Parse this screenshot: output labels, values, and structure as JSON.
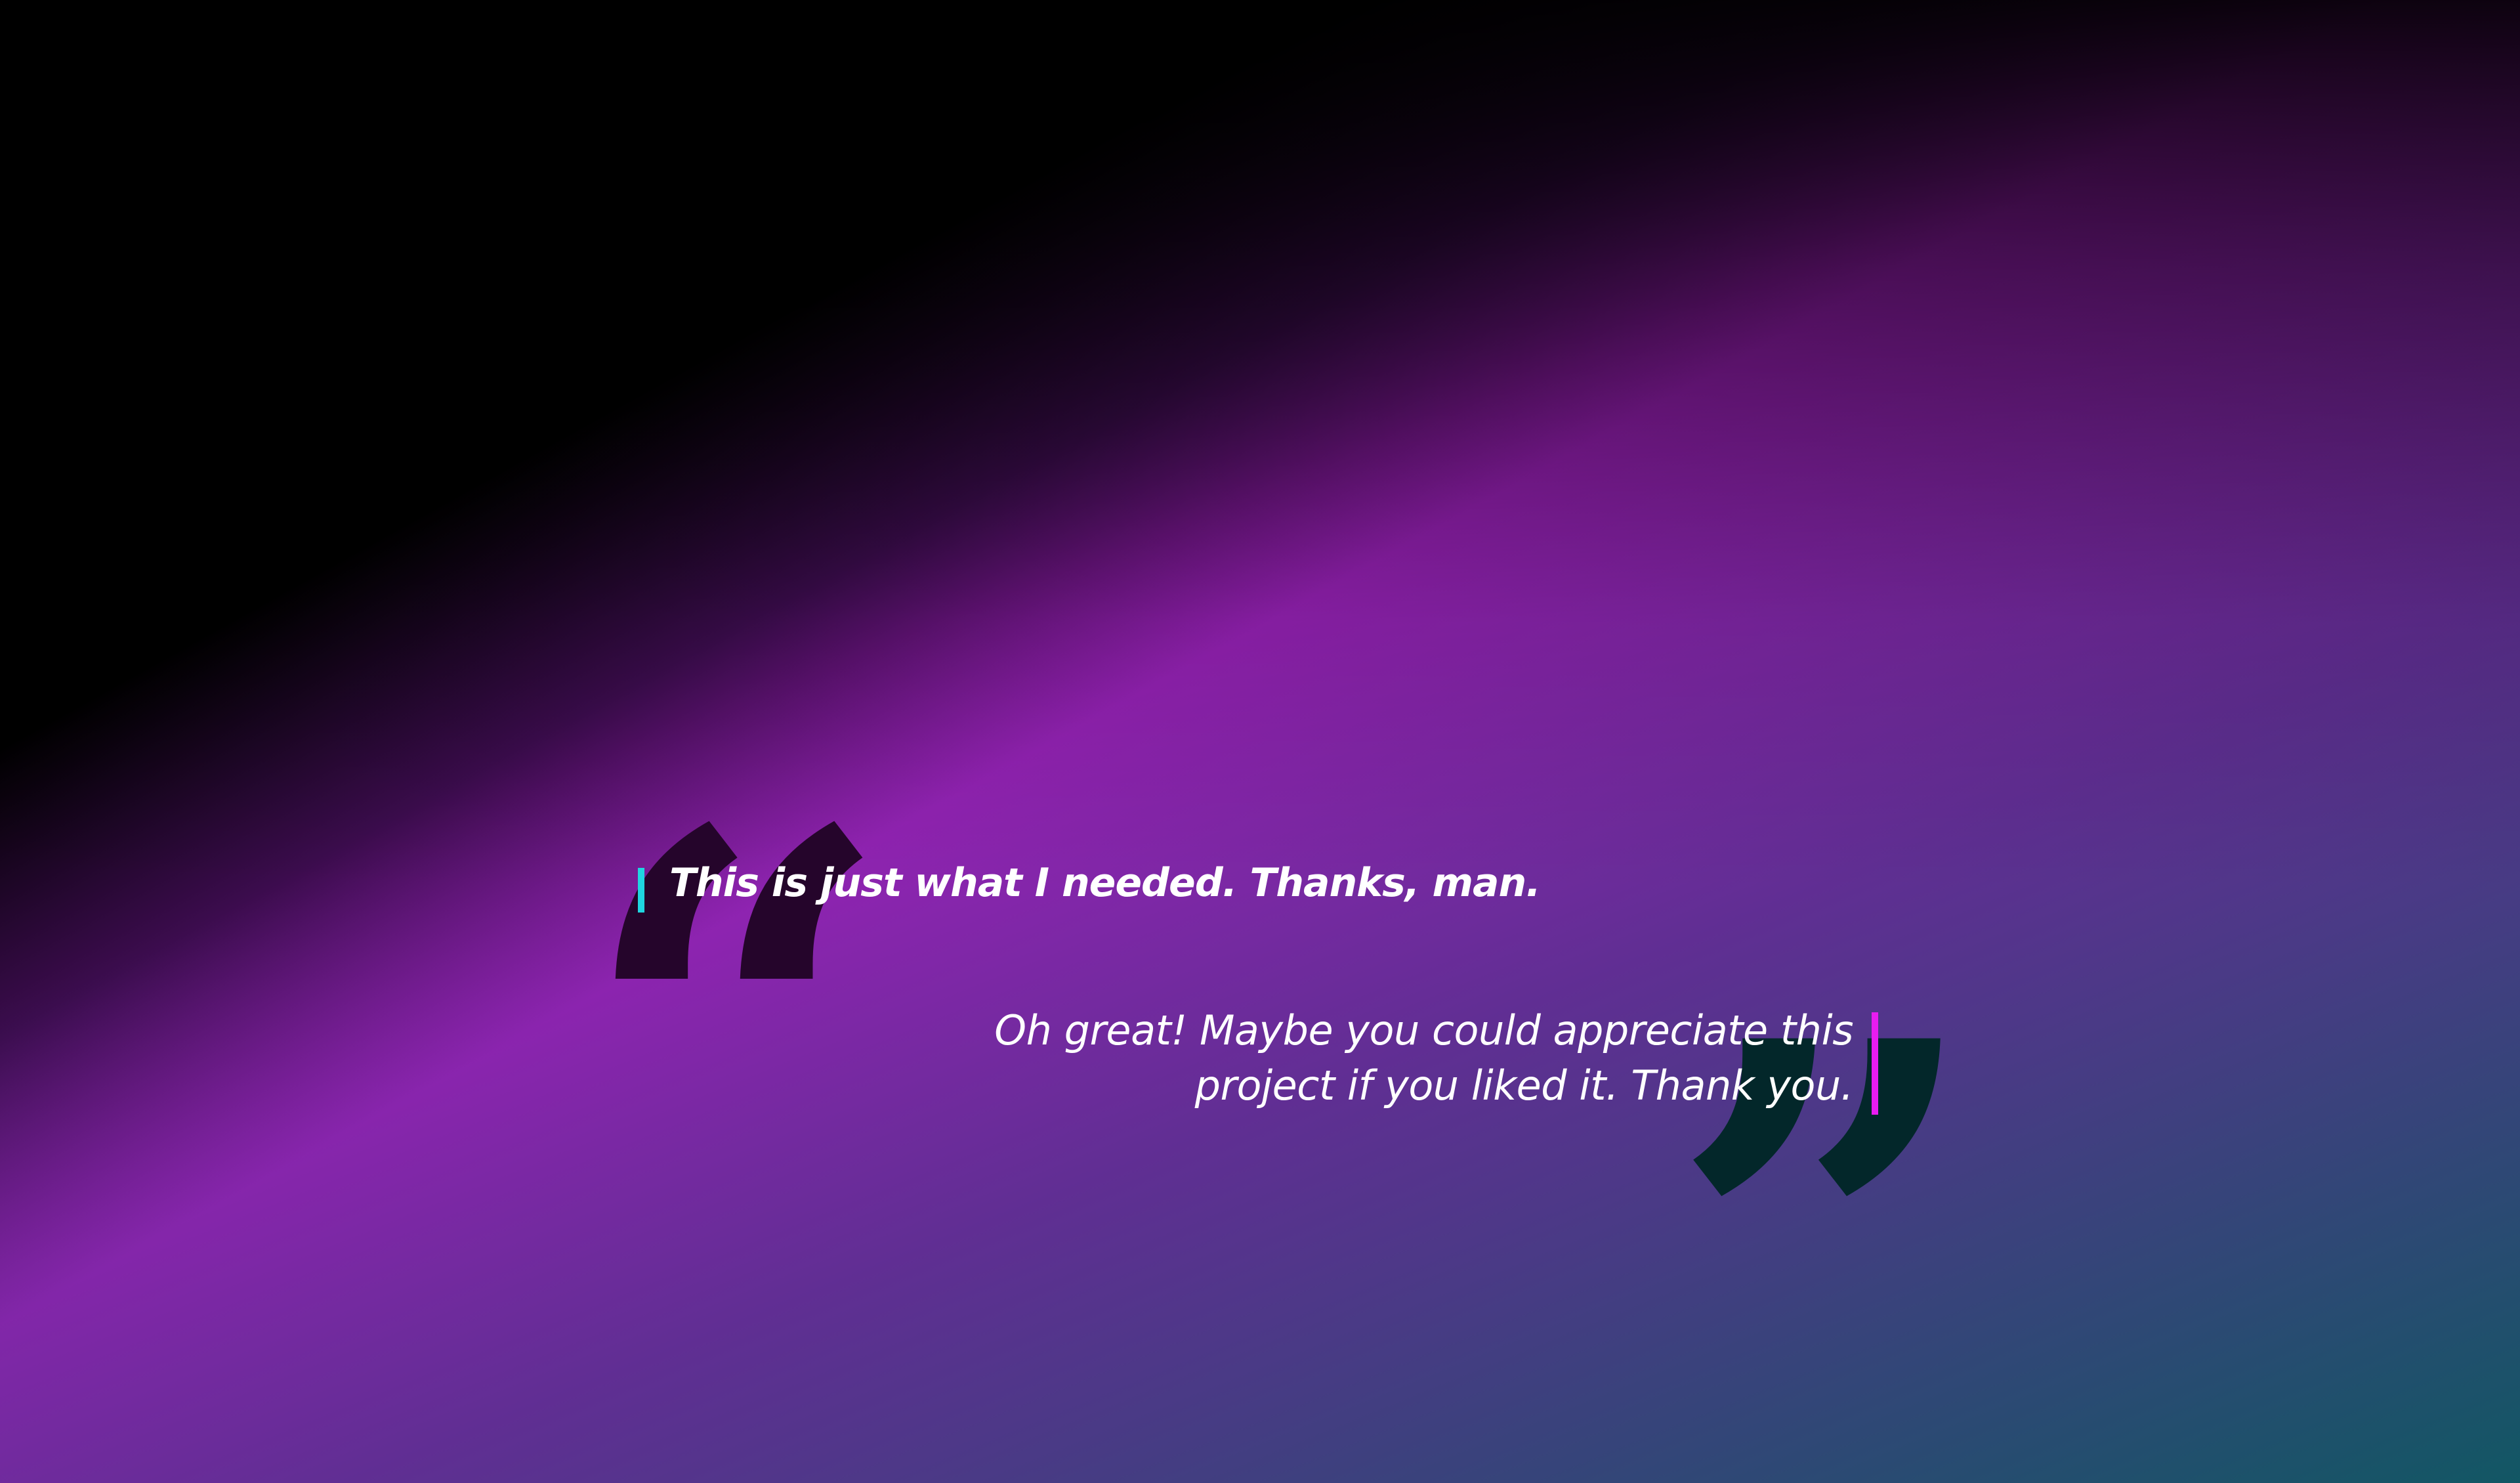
{
  "background": {
    "colors": [
      "#000000",
      "#a61ec0",
      "#2e3b6b",
      "#0d5a5e"
    ]
  },
  "quote_marks": {
    "open_glyph": "“",
    "close_glyph": "”",
    "open_color": "#25052b",
    "close_color": "#03272a"
  },
  "messages": [
    {
      "text": "This is just what I needed. Thanks, man.",
      "accent_color": "#1fd6e0"
    },
    {
      "text": "Oh great! Maybe you could appreciate this project if you liked it. Thank you.",
      "accent_color": "#e81cf0"
    }
  ]
}
